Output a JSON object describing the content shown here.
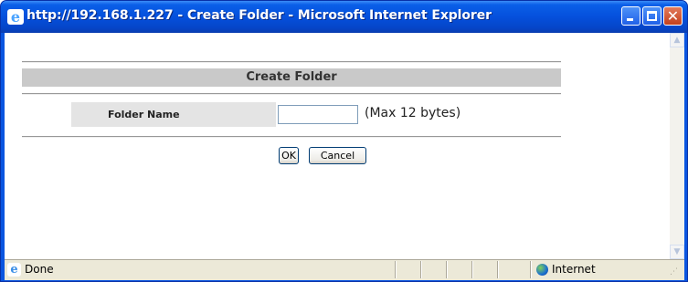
{
  "window": {
    "title": "http://192.168.1.227 - Create Folder - Microsoft Internet Explorer",
    "minimize_label": "_",
    "close_label": "✕"
  },
  "page": {
    "header": "Create Folder",
    "folder_name_label": "Folder Name",
    "folder_name_value": "",
    "folder_name_hint": "(Max 12 bytes)",
    "ok_label": "OK",
    "cancel_label": "Cancel"
  },
  "statusbar": {
    "status_text": "Done",
    "zone_text": "Internet"
  },
  "icons": {
    "title_icon": "ie-logo-icon",
    "status_icon": "ie-page-icon",
    "zone_icon": "globe-icon"
  },
  "colors": {
    "titlebar": "#0550dc",
    "header_bar": "#c9c9c9",
    "label_cell": "#e4e4e4",
    "statusbar": "#ece9d8"
  }
}
